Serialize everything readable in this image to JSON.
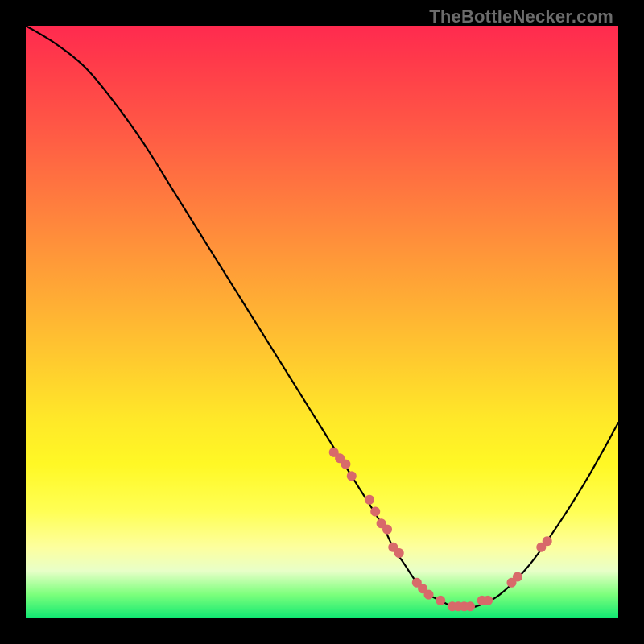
{
  "attribution": "TheBottleNecker.com",
  "chart_data": {
    "type": "line",
    "title": "",
    "xlabel": "",
    "ylabel": "",
    "xlim": [
      0,
      100
    ],
    "ylim": [
      0,
      100
    ],
    "series": [
      {
        "name": "bottleneck-curve",
        "x": [
          0,
          5,
          10,
          15,
          20,
          25,
          30,
          35,
          40,
          45,
          50,
          55,
          60,
          62,
          64,
          66,
          68,
          70,
          72,
          74,
          76,
          80,
          85,
          90,
          95,
          100
        ],
        "y": [
          100,
          97,
          93,
          87,
          80,
          72,
          64,
          56,
          48,
          40,
          32,
          24,
          16,
          12,
          9,
          6,
          4,
          3,
          2,
          2,
          2,
          4,
          9,
          16,
          24,
          33
        ]
      }
    ],
    "markers": {
      "name": "highlighted-points",
      "x": [
        52,
        53,
        54,
        55,
        58,
        59,
        60,
        61,
        62,
        63,
        66,
        67,
        68,
        70,
        72,
        73,
        74,
        75,
        77,
        78,
        82,
        83,
        87,
        88
      ],
      "y": [
        28,
        27,
        26,
        24,
        20,
        18,
        16,
        15,
        12,
        11,
        6,
        5,
        4,
        3,
        2,
        2,
        2,
        2,
        3,
        3,
        6,
        7,
        12,
        13
      ]
    },
    "marker_color": "#d86a6a",
    "curve_color": "#000000",
    "gradient_stops": [
      {
        "pos": 0.0,
        "color": "#ff2a4f"
      },
      {
        "pos": 0.5,
        "color": "#ffc330"
      },
      {
        "pos": 0.9,
        "color": "#ffff80"
      },
      {
        "pos": 1.0,
        "color": "#10e872"
      }
    ]
  }
}
